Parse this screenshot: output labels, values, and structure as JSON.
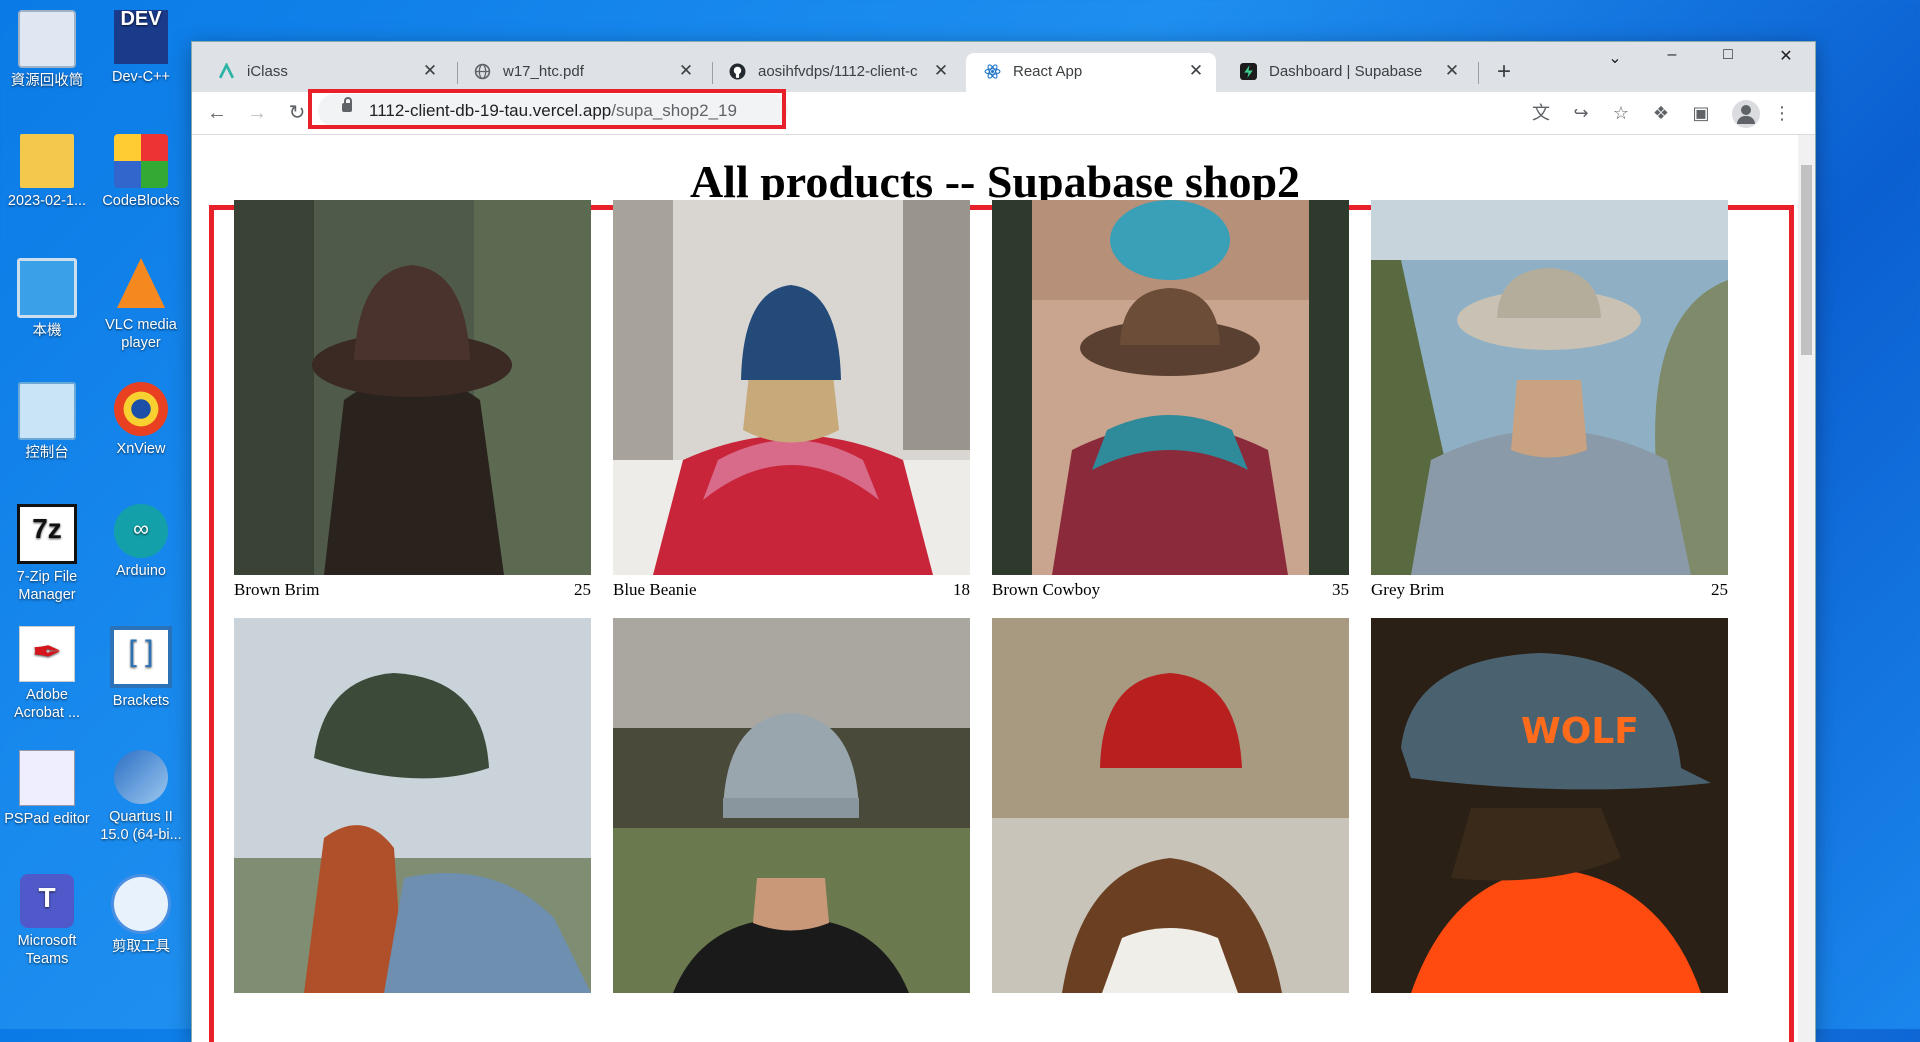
{
  "desktop": {
    "icons": [
      {
        "label": "資源回收筒",
        "icon": "recycle-bin-icon"
      },
      {
        "label": "Dev-C++",
        "icon": "devcpp-icon"
      },
      {
        "label": "2023-02-1...",
        "icon": "folder-icon"
      },
      {
        "label": "CodeBlocks",
        "icon": "codeblocks-icon"
      },
      {
        "label": "本機",
        "icon": "computer-icon"
      },
      {
        "label": "VLC media player",
        "icon": "vlc-icon"
      },
      {
        "label": "控制台",
        "icon": "control-panel-icon"
      },
      {
        "label": "XnView",
        "icon": "xnview-icon"
      },
      {
        "label": "7-Zip File Manager",
        "icon": "7zip-icon"
      },
      {
        "label": "Arduino",
        "icon": "arduino-icon"
      },
      {
        "label": "Adobe Acrobat ...",
        "icon": "acrobat-icon"
      },
      {
        "label": "Brackets",
        "icon": "brackets-icon"
      },
      {
        "label": "PSPad editor",
        "icon": "pspad-icon"
      },
      {
        "label": "Quartus II 15.0 (64-bi...",
        "icon": "quartus-icon"
      },
      {
        "label": "Microsoft Teams",
        "icon": "teams-icon"
      },
      {
        "label": "剪取工具",
        "icon": "snipping-tool-icon"
      }
    ],
    "dev_icon_text": "DEV",
    "sevenzip_icon_text": "7z"
  },
  "browser": {
    "tabs": [
      {
        "title": "iClass",
        "active": false
      },
      {
        "title": "w17_htc.pdf",
        "active": false
      },
      {
        "title": "aosihfvdps/1112-client-c",
        "active": false
      },
      {
        "title": "React App",
        "active": true
      },
      {
        "title": "Dashboard | Supabase",
        "active": false
      }
    ],
    "url_host": "1112-client-db-19-tau.vercel.app",
    "url_path": "/supa_shop2_19"
  },
  "page": {
    "title": "All products -- Supabase shop2",
    "products": [
      {
        "name": "Brown Brim",
        "price": "25"
      },
      {
        "name": "Blue Beanie",
        "price": "18"
      },
      {
        "name": "Brown Cowboy",
        "price": "35"
      },
      {
        "name": "Grey Brim",
        "price": "25"
      },
      {
        "name": "",
        "price": ""
      },
      {
        "name": "",
        "price": ""
      },
      {
        "name": "",
        "price": ""
      },
      {
        "name": "",
        "price": ""
      }
    ],
    "wolf_cap_text": "WOLF"
  },
  "colors": {
    "highlight": "#e8202a",
    "tabstrip": "#dee1e6"
  }
}
